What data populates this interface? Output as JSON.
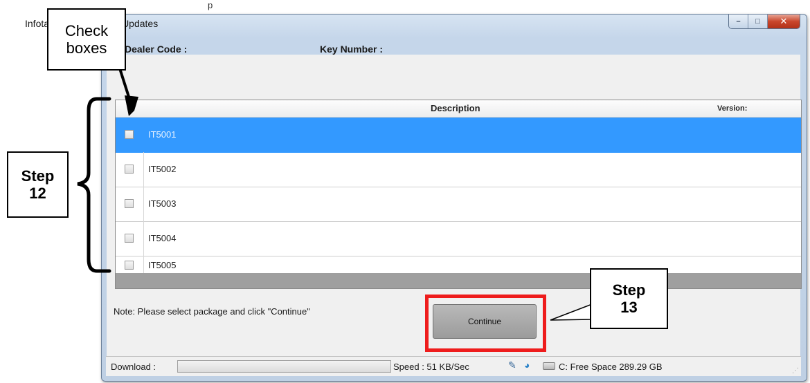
{
  "page_note": "p",
  "window": {
    "title": "Infotainment Software Updates",
    "controls": {
      "minimize": "–",
      "maximize": "□",
      "close": "✕"
    }
  },
  "fields": {
    "dealer_code_label": "Dealer Code :",
    "key_number_label": "Key Number :"
  },
  "grid": {
    "columns": {
      "description": "Description",
      "version": "Version:"
    },
    "rows": [
      {
        "label": "IT5001",
        "checked": false,
        "selected": true
      },
      {
        "label": "IT5002",
        "checked": false,
        "selected": false
      },
      {
        "label": "IT5003",
        "checked": false,
        "selected": false
      },
      {
        "label": "IT5004",
        "checked": false,
        "selected": false
      },
      {
        "label": "IT5005",
        "checked": false,
        "selected": false
      }
    ]
  },
  "note": "Note: Please select package and click \"Continue\"",
  "continue_button": {
    "label": "Continue"
  },
  "statusbar": {
    "download_label": "Download :",
    "speed_text": "Speed : 51 KB/Sec",
    "free_space": "C: Free Space 289.29 GB",
    "icons": [
      "plug-icon",
      "globe-icon",
      "drive-icon",
      "resize-grip-icon"
    ]
  },
  "callouts": {
    "check_boxes": [
      "Check",
      "boxes"
    ],
    "step12": [
      "Step",
      "12"
    ],
    "step13": [
      "Step",
      "13"
    ]
  },
  "colors": {
    "selection": "#3399ff",
    "highlight_frame": "#ee1c1c",
    "grid_footer": "#9f9f9f"
  }
}
